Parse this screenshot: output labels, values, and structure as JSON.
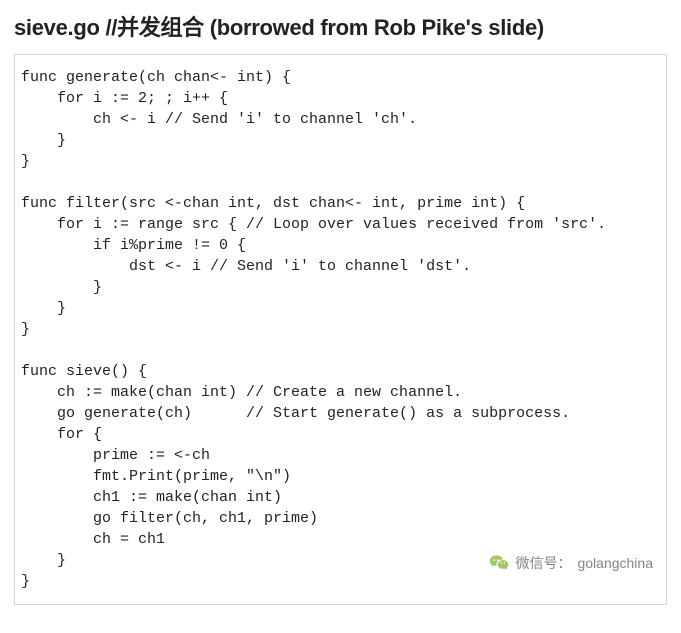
{
  "title": "sieve.go //并发组合 (borrowed from Rob Pike's slide)",
  "code": "func generate(ch chan<- int) {\n    for i := 2; ; i++ {\n        ch <- i // Send 'i' to channel 'ch'.\n    }\n}\n\nfunc filter(src <-chan int, dst chan<- int, prime int) {\n    for i := range src { // Loop over values received from 'src'.\n        if i%prime != 0 {\n            dst <- i // Send 'i' to channel 'dst'.\n        }\n    }\n}\n\nfunc sieve() {\n    ch := make(chan int) // Create a new channel.\n    go generate(ch)      // Start generate() as a subprocess.\n    for {\n        prime := <-ch\n        fmt.Print(prime, \"\\n\")\n        ch1 := make(chan int)\n        go filter(ch, ch1, prime)\n        ch = ch1\n    }\n}",
  "watermark": {
    "label": "微信号：",
    "value": "golangchina"
  }
}
